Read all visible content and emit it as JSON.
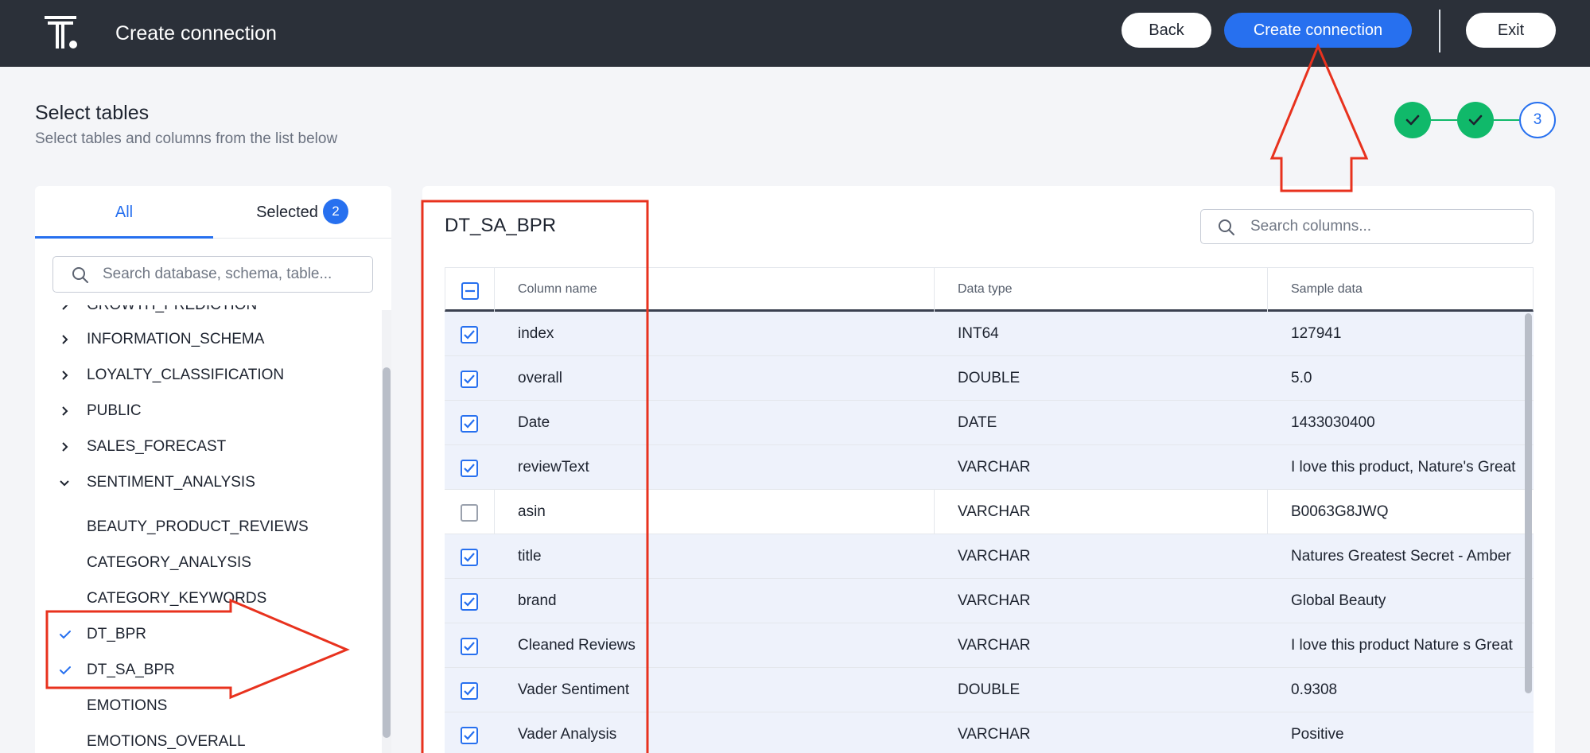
{
  "header": {
    "title": "Create connection",
    "back_label": "Back",
    "create_label": "Create connection",
    "exit_label": "Exit"
  },
  "section": {
    "title": "Select tables",
    "subtitle": "Select tables and columns from the list below"
  },
  "stepper": {
    "steps": [
      "done",
      "done",
      "3"
    ],
    "current_step": "3"
  },
  "left_panel": {
    "tabs": {
      "all": "All",
      "selected": "Selected",
      "selected_count": "2"
    },
    "search_placeholder": "Search database, schema, table...",
    "tree": [
      {
        "label": "GROWTH_PREDICTION",
        "kind": "schema",
        "state": "collapsed"
      },
      {
        "label": "INFORMATION_SCHEMA",
        "kind": "schema",
        "state": "collapsed"
      },
      {
        "label": "LOYALTY_CLASSIFICATION",
        "kind": "schema",
        "state": "collapsed"
      },
      {
        "label": "PUBLIC",
        "kind": "schema",
        "state": "collapsed"
      },
      {
        "label": "SALES_FORECAST",
        "kind": "schema",
        "state": "collapsed"
      },
      {
        "label": "SENTIMENT_ANALYSIS",
        "kind": "schema",
        "state": "expanded"
      },
      {
        "label": "BEAUTY_PRODUCT_REVIEWS",
        "kind": "table",
        "checked": false
      },
      {
        "label": "CATEGORY_ANALYSIS",
        "kind": "table",
        "checked": false
      },
      {
        "label": "CATEGORY_KEYWORDS",
        "kind": "table",
        "checked": false
      },
      {
        "label": "DT_BPR",
        "kind": "table",
        "checked": true
      },
      {
        "label": "DT_SA_BPR",
        "kind": "table",
        "checked": true
      },
      {
        "label": "EMOTIONS",
        "kind": "table",
        "checked": false
      },
      {
        "label": "EMOTIONS_OVERALL",
        "kind": "table",
        "checked": false
      }
    ]
  },
  "right_panel": {
    "table_name": "DT_SA_BPR",
    "search_placeholder": "Search columns...",
    "headers": {
      "name": "Column name",
      "type": "Data type",
      "sample": "Sample data"
    },
    "rows": [
      {
        "checked": true,
        "name": "index",
        "type": "INT64",
        "sample": "127941"
      },
      {
        "checked": true,
        "name": "overall",
        "type": "DOUBLE",
        "sample": "5.0"
      },
      {
        "checked": true,
        "name": "Date",
        "type": "DATE",
        "sample": "1433030400"
      },
      {
        "checked": true,
        "name": "reviewText",
        "type": "VARCHAR",
        "sample": "I love this product, Nature's Great"
      },
      {
        "checked": false,
        "name": "asin",
        "type": "VARCHAR",
        "sample": "B0063G8JWQ"
      },
      {
        "checked": true,
        "name": "title",
        "type": "VARCHAR",
        "sample": "Natures Greatest Secret - Amber"
      },
      {
        "checked": true,
        "name": "brand",
        "type": "VARCHAR",
        "sample": "Global Beauty"
      },
      {
        "checked": true,
        "name": "Cleaned Reviews",
        "type": "VARCHAR",
        "sample": "I love this product Nature s Great"
      },
      {
        "checked": true,
        "name": "Vader Sentiment",
        "type": "DOUBLE",
        "sample": "0.9308"
      },
      {
        "checked": true,
        "name": "Vader Analysis",
        "type": "VARCHAR",
        "sample": "Positive"
      }
    ]
  },
  "colors": {
    "header_bg": "#2b3039",
    "primary": "#2770ef",
    "success": "#10b96a",
    "annotation": "#e8321e"
  }
}
